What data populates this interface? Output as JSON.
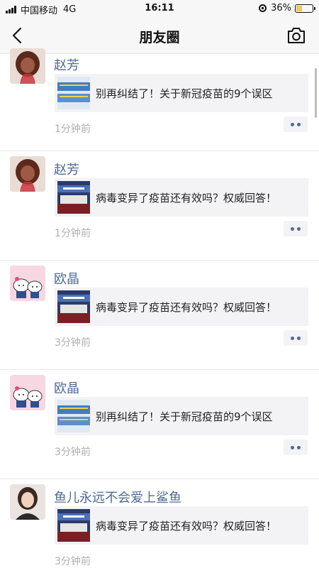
{
  "status_bar": {
    "carrier": "中国移动",
    "network": "4G",
    "time": "16:11",
    "battery": "36%",
    "battery_level": 0.36
  },
  "nav": {
    "title": "朋友圈",
    "back_icon": "chevron-left-icon",
    "camera_icon": "camera-icon"
  },
  "posts": [
    {
      "name": "赵芳",
      "share_title": "别再纠结了！关于新冠疫苗的9个误区",
      "time": "1分钟前"
    },
    {
      "name": "赵芳",
      "share_title": "病毒变异了疫苗还有效吗？权威回答！",
      "time": "1分钟前"
    },
    {
      "name": "欧晶",
      "share_title": "病毒变异了疫苗还有效吗？权威回答！",
      "time": "3分钟前"
    },
    {
      "name": "欧晶",
      "share_title": "别再纠结了！关于新冠疫苗的9个误区",
      "time": "3分钟前"
    },
    {
      "name": "鱼儿永远不会爱上鲨鱼",
      "share_title": "病毒变异了疫苗还有效吗？权威回答！",
      "time": "3分钟前"
    }
  ],
  "colors": {
    "name_link": "#4d6a96",
    "card_bg": "#f3f3f5",
    "time_text": "#b0b0b0",
    "bar_bg": "#f7f7f7"
  }
}
